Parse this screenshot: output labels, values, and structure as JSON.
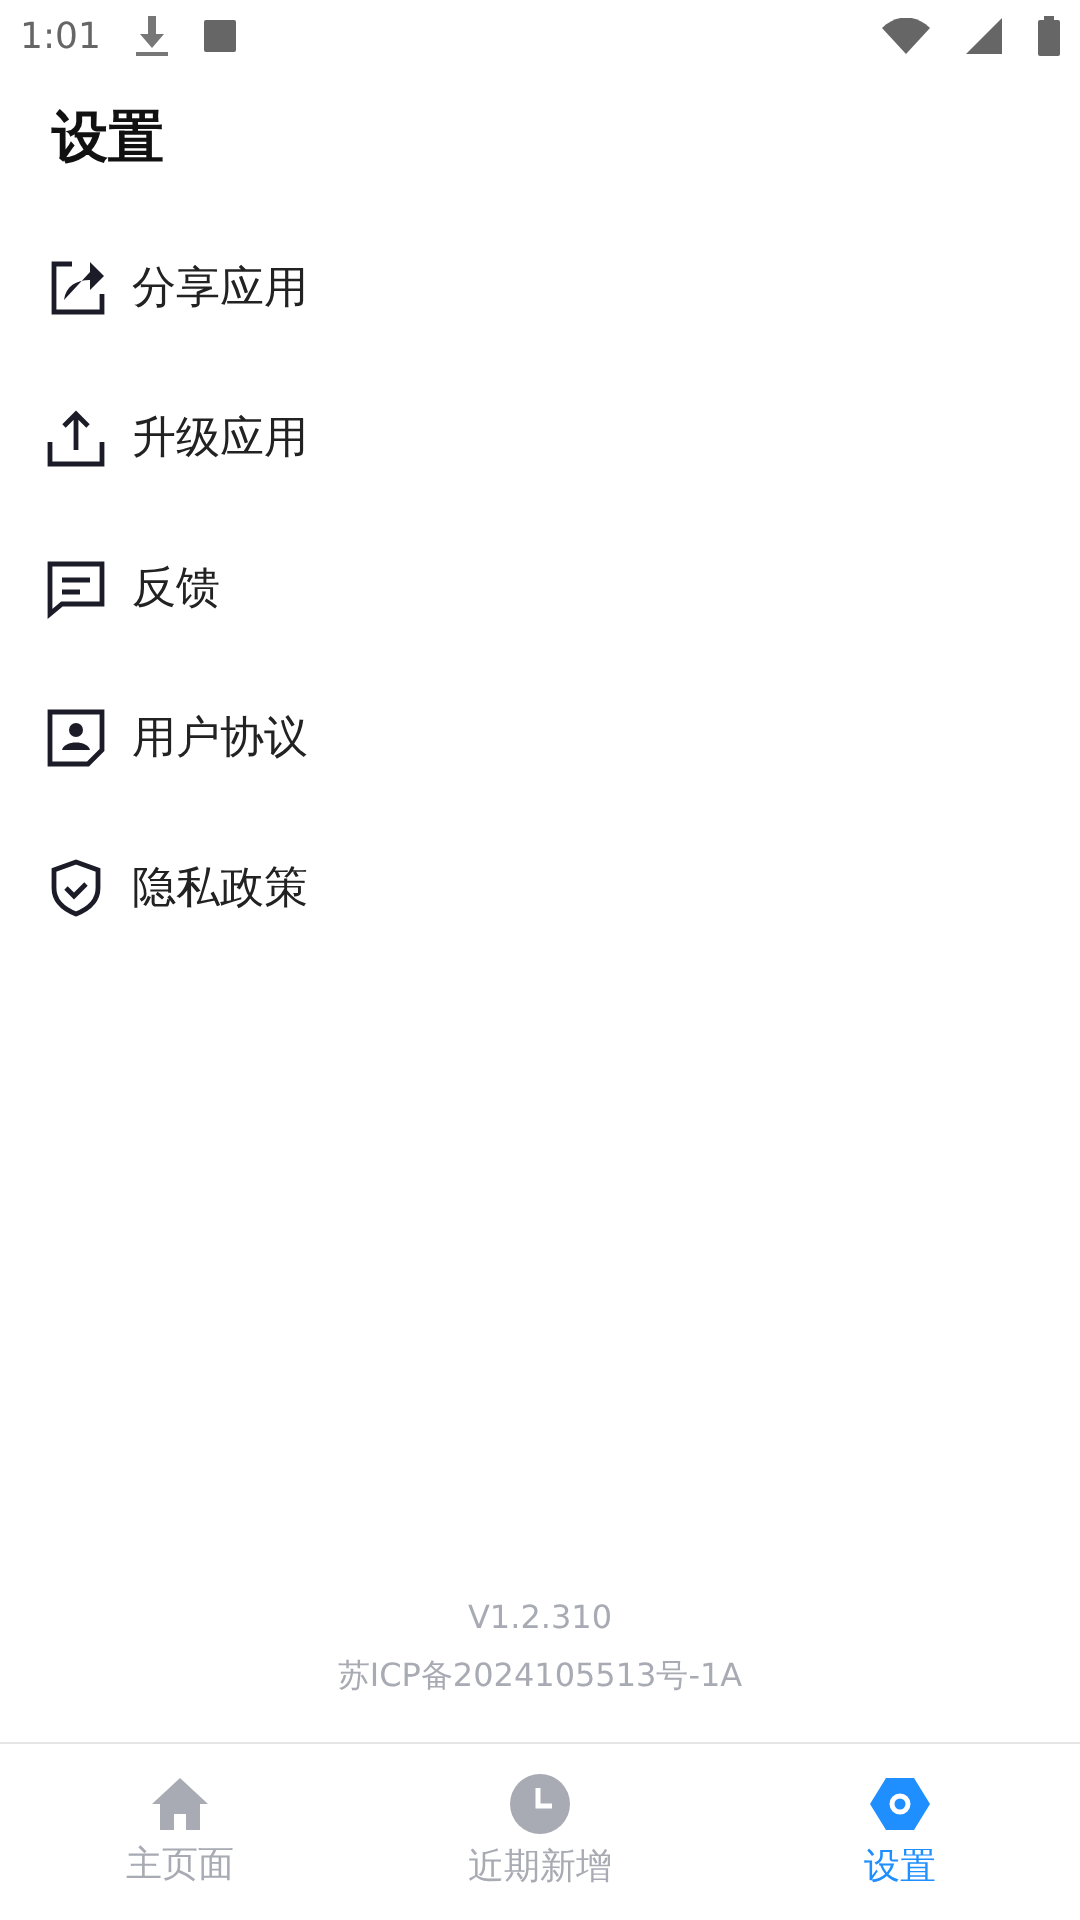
{
  "status_bar": {
    "time": "1:01"
  },
  "title": "设置",
  "menu_items": [
    {
      "kind": "share",
      "label": "分享应用"
    },
    {
      "kind": "upgrade",
      "label": "升级应用"
    },
    {
      "kind": "feedback",
      "label": "反馈"
    },
    {
      "kind": "agreement",
      "label": "用户协议"
    },
    {
      "kind": "privacy",
      "label": "隐私政策"
    }
  ],
  "footer": {
    "version": "V1.2.310",
    "license": "苏ICP备2024105513号-1A"
  },
  "bottom_nav": [
    {
      "kind": "home",
      "label": "主页面",
      "selected": false
    },
    {
      "kind": "recent",
      "label": "近期新增",
      "selected": false
    },
    {
      "kind": "settings",
      "label": "设置",
      "selected": true
    }
  ]
}
